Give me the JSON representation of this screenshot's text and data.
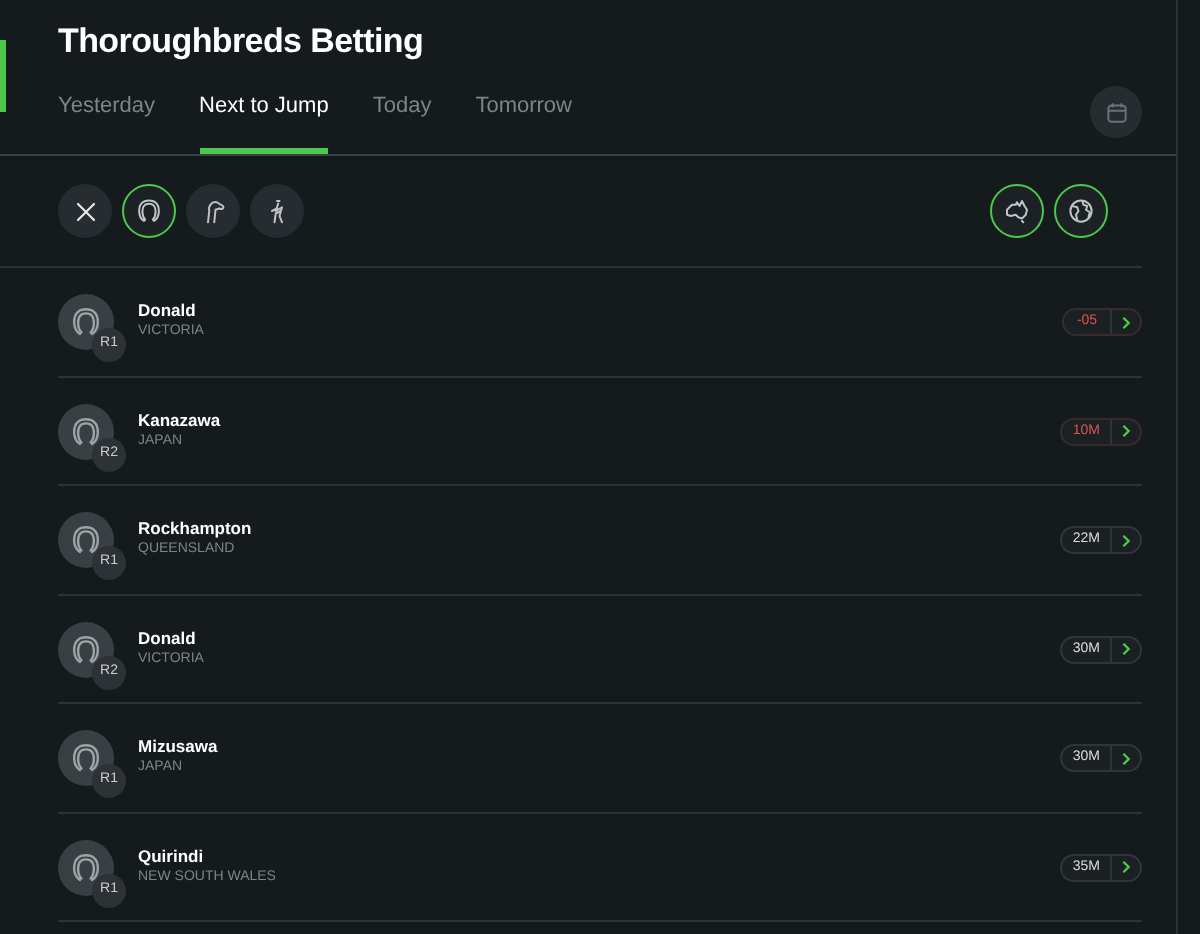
{
  "title": "Thoroughbreds Betting",
  "tabs": [
    {
      "label": "Yesterday",
      "selected": false
    },
    {
      "label": "Next to Jump",
      "selected": true
    },
    {
      "label": "Today",
      "selected": false
    },
    {
      "label": "Tomorrow",
      "selected": false
    }
  ],
  "filters": [
    {
      "kind": "clear",
      "selected": false
    },
    {
      "kind": "horse",
      "selected": true
    },
    {
      "kind": "greyhound",
      "selected": false
    },
    {
      "kind": "harness",
      "selected": false
    }
  ],
  "regions": [
    {
      "kind": "australia",
      "selected": true
    },
    {
      "kind": "world",
      "selected": true
    }
  ],
  "races": [
    {
      "venue": "Donald",
      "region": "VICTORIA",
      "race": "R1",
      "time": "-05",
      "urgent": true
    },
    {
      "venue": "Kanazawa",
      "region": "JAPAN",
      "race": "R2",
      "time": "10M",
      "urgent": true
    },
    {
      "venue": "Rockhampton",
      "region": "QUEENSLAND",
      "race": "R1",
      "time": "22M",
      "urgent": false
    },
    {
      "venue": "Donald",
      "region": "VICTORIA",
      "race": "R2",
      "time": "30M",
      "urgent": false
    },
    {
      "venue": "Mizusawa",
      "region": "JAPAN",
      "race": "R1",
      "time": "30M",
      "urgent": false
    },
    {
      "venue": "Quirindi",
      "region": "NEW SOUTH WALES",
      "race": "R1",
      "time": "35M",
      "urgent": false
    }
  ]
}
